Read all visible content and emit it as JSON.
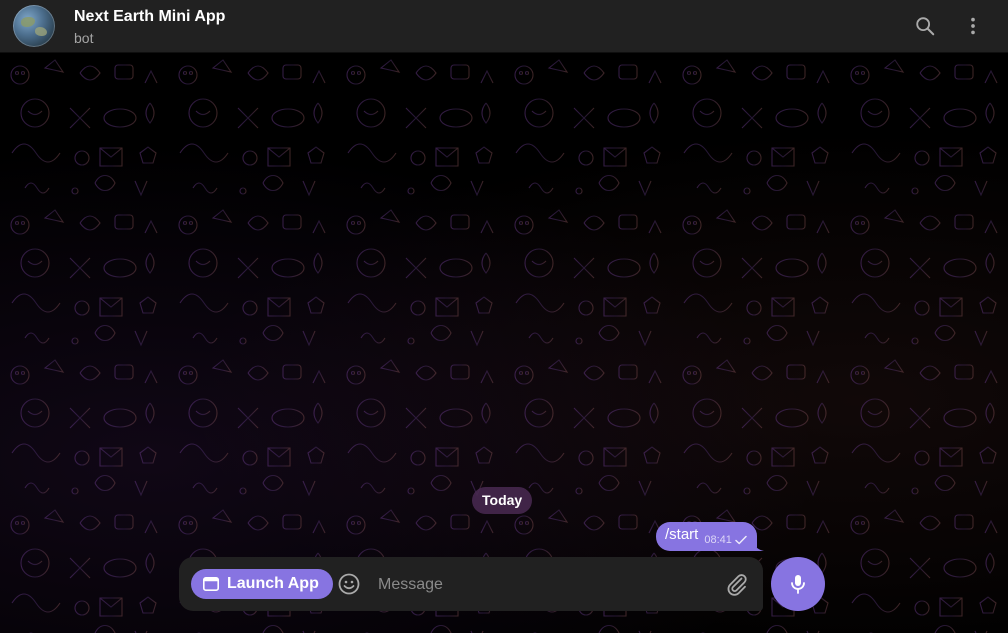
{
  "header": {
    "title": "Next Earth Mini App",
    "subtitle": "bot",
    "search_icon": "search-icon",
    "menu_icon": "more-vertical-icon"
  },
  "chat": {
    "date_label": "Today",
    "messages": [
      {
        "text": "/start",
        "time": "08:41",
        "status": "sent",
        "outgoing": true
      }
    ]
  },
  "composer": {
    "launch_label": "Launch App",
    "placeholder": "Message",
    "value": ""
  },
  "colors": {
    "accent": "#8774e1",
    "header_bg": "#212121",
    "composer_bg": "#212121",
    "chat_bg": "#000000",
    "date_chip_bg": "#4a2a52"
  }
}
